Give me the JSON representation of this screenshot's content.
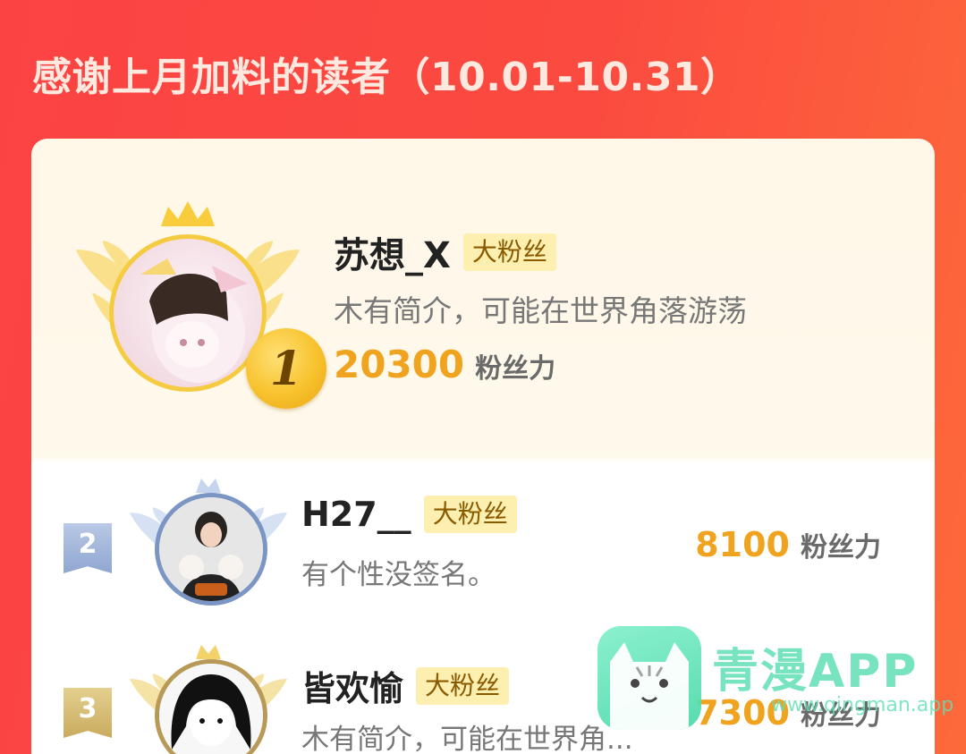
{
  "header": {
    "title": "感谢上月加料的读者（10.01-10.31）"
  },
  "first_place": {
    "rank": "1",
    "name": "苏想_X",
    "badge": "大粉丝",
    "bio": "木有简介，可能在世界角落游荡",
    "fans_value": "20300",
    "fans_unit": "粉丝力"
  },
  "ranking": [
    {
      "rank": "2",
      "name": "H27__",
      "badge": "大粉丝",
      "bio": "有个性没签名。",
      "fans_value": "8100",
      "fans_unit": "粉丝力"
    },
    {
      "rank": "3",
      "name": "皆欢愉",
      "badge": "大粉丝",
      "bio": "木有简介，可能在世界角...",
      "fans_value": "7300",
      "fans_unit": "粉丝力"
    }
  ],
  "watermark": {
    "title": "青漫APP",
    "url": "www.qingman.app"
  },
  "colors": {
    "background": "#fb4343",
    "fans_accent": "#f0a31e",
    "badge_bg": "#fcefb0",
    "gold": "#f5cc41",
    "silver": "#7b96c4",
    "bronze": "#c9ab5e"
  }
}
